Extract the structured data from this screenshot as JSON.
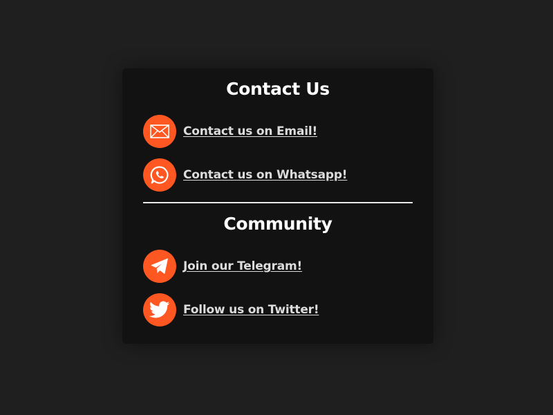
{
  "contact": {
    "title": "Contact Us",
    "items": [
      {
        "label": "Contact us on Email!",
        "icon": "email-icon"
      },
      {
        "label": "Contact us on Whatsapp!",
        "icon": "whatsapp-icon"
      }
    ]
  },
  "community": {
    "title": "Community",
    "items": [
      {
        "label": "Join our Telegram!",
        "icon": "telegram-icon"
      },
      {
        "label": "Follow us on Twitter!",
        "icon": "twitter-icon"
      }
    ]
  },
  "colors": {
    "accent": "#fe5722",
    "background": "#1f1f20",
    "card": "#121212",
    "text": "#ffffff",
    "link": "#dcdcdc"
  }
}
